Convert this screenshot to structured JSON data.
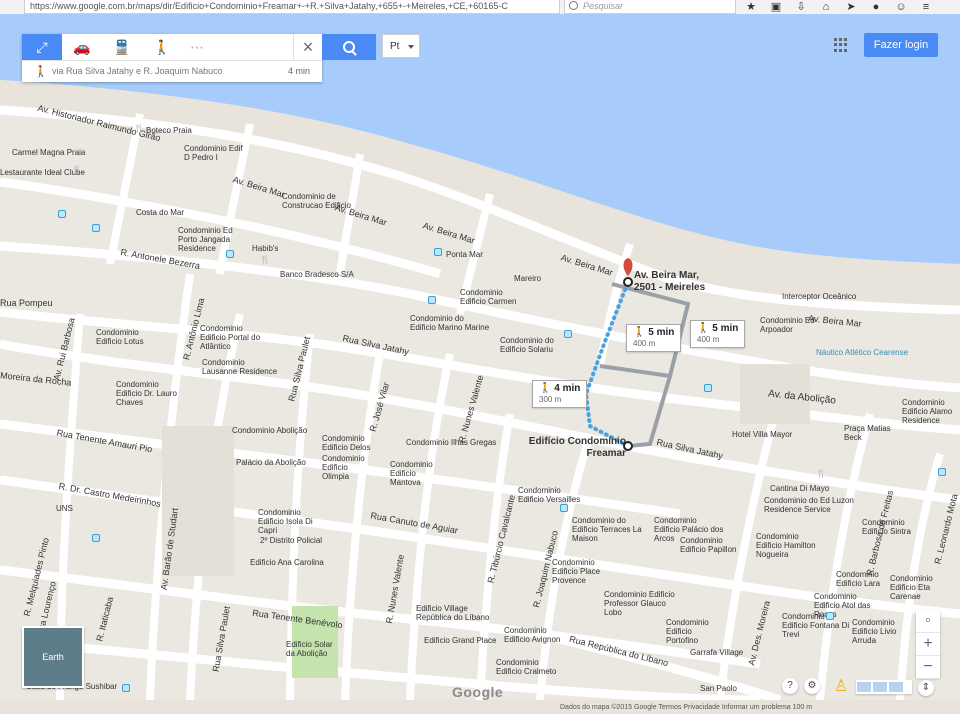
{
  "browser": {
    "url": "https://www.google.com.br/maps/dir/Edificio+Condominio+Freamar+-+R.+Silva+Jatahy,+655+-+Meireles,+CE,+60165-C",
    "search_placeholder": "Pesquisar"
  },
  "directions": {
    "mode_icons": [
      "directions-icon",
      "car-icon",
      "transit-icon",
      "walk-icon",
      "more-icon"
    ],
    "route_summary": "via Rua Silva Jatahy e R. Joaquim Nabuco",
    "route_time": "4 min"
  },
  "header": {
    "language": "Pt",
    "login": "Fazer login"
  },
  "map": {
    "streets": [
      "Av. Historiador Raimundo Girão",
      "Av. Beira Mar",
      "R. Antonele Bezerra",
      "Rua Silva Jatahy",
      "Av. da Abolição",
      "Rua Tenente Amauri Pio",
      "R. Dr. Castro Medeirinhos",
      "Rua Canuto de Aguiar",
      "Rua Tenente Benévolo",
      "Rua República do Líbano",
      "Av. Rui Barbosa",
      "R. Antônio Lima",
      "Rua Silva Paulet",
      "R. José Vilar",
      "R. Nunes Valente",
      "R. Tibúrcio Cavalcante",
      "R. Joaquim Nabuco",
      "Av. Barão de Studart",
      "R. Marcos Macedo",
      "Av. Des. Moreira",
      "R. Barbosa de Freitas",
      "R. Leonardo Mota",
      "Rua Ildefonso Albano",
      "Rua Pompeu",
      "Moreira da Rocha",
      "R. Melquiades Pinto",
      "Rua Lourenço",
      "R. Itaticaba"
    ],
    "places": [
      "Boteco Praia",
      "Carmel Magna Praia",
      "Lestaurante Ideal Clube",
      "Ideal Club",
      "Rui Barbosa",
      "Condominio Edif D Pedro I",
      "Condominio de Construcao Edificio",
      "Costa do Mar",
      "Condominio Ed Porto Jangada Residence",
      "Habib's",
      "Banco Bradesco S/A",
      "Ponta Mar",
      "Mareiro",
      "Condominio Edificio Carmen",
      "Condominio do Edificio Marino Marine",
      "Condominio Edificio Lotus",
      "Condominio Edificio Portal do Atlântico",
      "Condominio do Edificio Solariu",
      "Condominio Lausanne Residence",
      "Condominio Edificio Dr. Lauro Chaves",
      "Condominio Abolição",
      "Palácio da Abolição",
      "Condominio Edificio Delos",
      "Condominio Edificio Olimpia",
      "Condominio Ilhas Gregas",
      "Condominio Edificio Mantova",
      "Condominio Edificio Isola Di Capri",
      "2º Distrito Policial",
      "Edificio Ana Carolina",
      "Condominio Edificio Versailles",
      "Condominio do Edificio Terraces La Maison",
      "Condominio Edificio Palácio dos Arcos",
      "Condominio Edificio Papillon",
      "Condominio Edificio Place Provence",
      "Condominio Edificio Professor Glauco Lobo",
      "Edificio Village República do Líbano",
      "Condominio Edificio Avignon",
      "Condominio Edificio Portofino",
      "Edificio Grand Place",
      "Edificio Solar da Abolição",
      "Condominio Edificio Cralmeto",
      "Garrafa Village",
      "San Paolo",
      "Hotel Villa Mayor",
      "Praça Matias Beck",
      "Cantina Di Mayo",
      "Condominio do Ed Luzon Residence Service",
      "Condominio Edificio Hamilton Nogueira",
      "Condominio Edificio Sintra",
      "Condominio Edificio Lara",
      "Condominio Edificio Atol das Rocas",
      "Condominio Edificio Fontana Di Trevi",
      "Condominio Edificio Livio Arruda",
      "Condominio Edificio Eta Carenae",
      "Condominio Edificio Alamo Residence",
      "Interceptor Oceânico",
      "Condominio Ed Arpoador",
      "Náutico Atlético Cearense",
      "Casa do Frango Sushibar",
      "UNS"
    ],
    "marker_a": "Av. Beira Mar, 2501 - Meireles",
    "marker_b": "Edifício Condomínio Freamar",
    "walk_1_time": "5 min",
    "walk_1_dist": "400 m",
    "walk_2_time": "5 min",
    "walk_2_dist": "400 m",
    "walk_3_time": "4 min",
    "walk_3_dist": "300 m",
    "earth": "Earth",
    "google": "Google",
    "zoom_in": "+",
    "zoom_out": "−",
    "bottom_text": "Dados do mapa ©2015 Google   Termos   Privacidade   Informar um problema   100 m"
  }
}
